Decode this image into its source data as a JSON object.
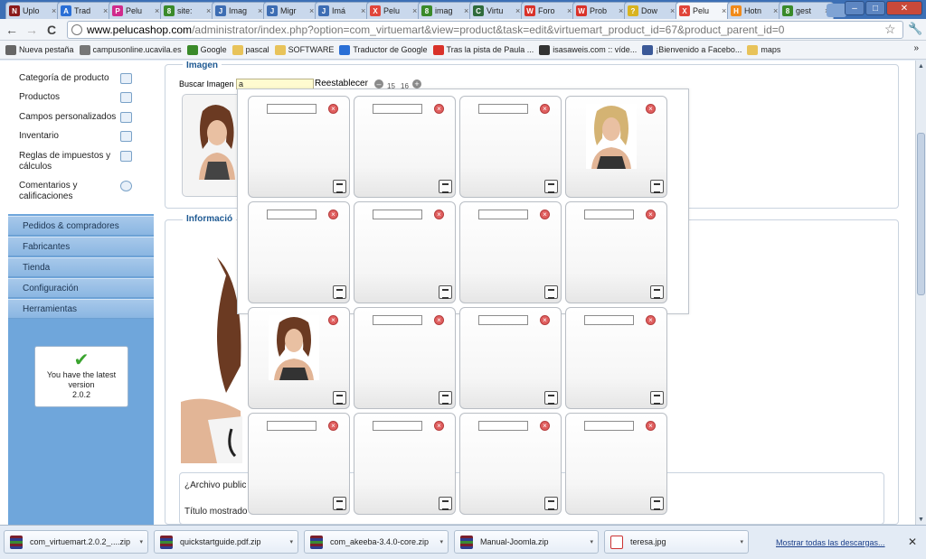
{
  "browser": {
    "tabs": [
      {
        "label": "Uplo",
        "color": "#8b1a1a",
        "glyph": "N"
      },
      {
        "label": "Trad",
        "color": "#2a6fd6",
        "glyph": "A"
      },
      {
        "label": "Pelu",
        "color": "#d02a8c",
        "glyph": "P"
      },
      {
        "label": "site:",
        "color": "#3a8a2a",
        "glyph": "8"
      },
      {
        "label": "Imag",
        "color": "#3d6db3",
        "glyph": "J"
      },
      {
        "label": "Migr",
        "color": "#3d6db3",
        "glyph": "J"
      },
      {
        "label": "Imá",
        "color": "#3d6db3",
        "glyph": "J"
      },
      {
        "label": "Pelu",
        "color": "#e0453a",
        "glyph": "X"
      },
      {
        "label": "imag",
        "color": "#3a8a2a",
        "glyph": "8"
      },
      {
        "label": "Virtu",
        "color": "#2f6b3b",
        "glyph": "C"
      },
      {
        "label": "Foro",
        "color": "#d9322a",
        "glyph": "W"
      },
      {
        "label": "Prob",
        "color": "#d9322a",
        "glyph": "W"
      },
      {
        "label": "Dow",
        "color": "#d8b320",
        "glyph": "?"
      },
      {
        "label": "Pelu",
        "color": "#e0453a",
        "glyph": "X"
      },
      {
        "label": "Hotn",
        "color": "#f08a1a",
        "glyph": "H"
      },
      {
        "label": "gest",
        "color": "#3a8a2a",
        "glyph": "8"
      }
    ],
    "tab_close": "×",
    "win_min": "–",
    "win_max": "□",
    "win_close": "✕",
    "url_host": "www.pelucashop.com",
    "url_path": "/administrator/index.php?option=com_virtuemart&view=product&task=edit&virtuemart_product_id=67&product_parent_id=0",
    "back": "←",
    "forward": "→",
    "reload": "C",
    "star": "☆",
    "wrench": "🔧",
    "bookmarks": [
      {
        "label": "Nueva pestaña",
        "color": "#666"
      },
      {
        "label": "campusonline.ucavila.es",
        "color": "#777"
      },
      {
        "label": "Google",
        "color": "#3a8a2a"
      },
      {
        "label": "pascal",
        "color": "#e8c35a"
      },
      {
        "label": "SOFTWARE",
        "color": "#e8c35a"
      },
      {
        "label": "Traductor de Google",
        "color": "#2a6fd6"
      },
      {
        "label": "Tras la pista de Paula ...",
        "color": "#d9322a"
      },
      {
        "label": "isasaweis.com :: víde...",
        "color": "#333"
      },
      {
        "label": "¡Bienvenido a Facebo...",
        "color": "#3b5998"
      },
      {
        "label": "maps",
        "color": "#e8c35a"
      }
    ],
    "bookmarks_more": "»"
  },
  "sidebar": {
    "items": [
      {
        "label": "Categoría de producto"
      },
      {
        "label": "Productos"
      },
      {
        "label": "Campos personalizados"
      },
      {
        "label": "Inventario"
      },
      {
        "label": "Reglas de impuestos y cálculos"
      },
      {
        "label": "Comentarios y calificaciones"
      }
    ],
    "sections": [
      {
        "label": "Pedidos & compradores"
      },
      {
        "label": "Fabricantes"
      },
      {
        "label": "Tienda"
      },
      {
        "label": "Configuración"
      },
      {
        "label": "Herramientas"
      }
    ],
    "version": {
      "check": "✔",
      "line1": "You have the latest version",
      "line2": "2.0.2"
    }
  },
  "main": {
    "image_legend": "Imagen",
    "search_label": "Buscar Imagen :",
    "search_value": "a",
    "reset_label": "Reestablecer",
    "pager_prev": "–",
    "pager_next": "+",
    "pager_a": "15",
    "pager_b": "16",
    "info_legend": "Informació",
    "archivo_label": "¿Archivo public",
    "titulo_label": "Título mostrado"
  },
  "popup": {
    "delete_glyph": "×",
    "cells": [
      {
        "has_image": false
      },
      {
        "has_image": false
      },
      {
        "has_image": false
      },
      {
        "has_image": true,
        "hair": "blonde"
      },
      {
        "has_image": false
      },
      {
        "has_image": false
      },
      {
        "has_image": false
      },
      {
        "has_image": false
      },
      {
        "has_image": true,
        "hair": "auburn"
      },
      {
        "has_image": false
      },
      {
        "has_image": false
      },
      {
        "has_image": false
      },
      {
        "has_image": false
      },
      {
        "has_image": false
      },
      {
        "has_image": false
      },
      {
        "has_image": false
      }
    ]
  },
  "downloads": {
    "items": [
      {
        "label": "com_virtuemart.2.0.2_....zip",
        "type": "zip"
      },
      {
        "label": "quickstartguide.pdf.zip",
        "type": "zip"
      },
      {
        "label": "com_akeeba-3.4.0-core.zip",
        "type": "zip"
      },
      {
        "label": "Manual-Joomla.zip",
        "type": "zip"
      },
      {
        "label": "teresa.jpg",
        "type": "pdf"
      }
    ],
    "dropdown": "▾",
    "show_all": "Mostrar todas las descargas...",
    "close": "✕"
  }
}
